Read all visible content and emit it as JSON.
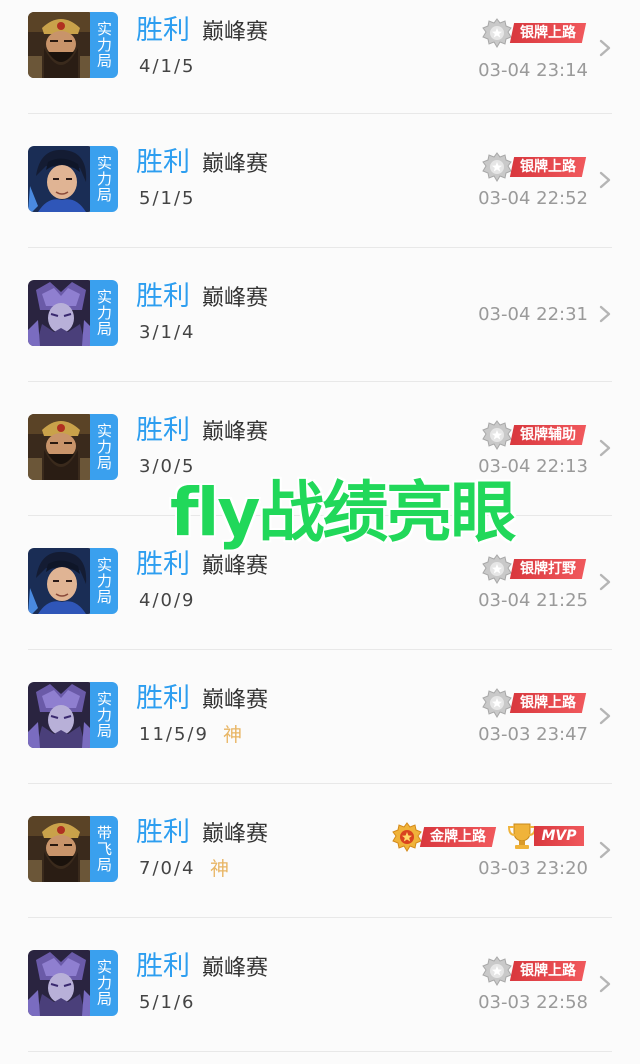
{
  "matches": [
    {
      "hero_icon": "hero-bearded-warrior-icon",
      "mode_badge": "实力局",
      "result": "胜利",
      "mode": "巅峰赛",
      "kda": "4/1/5",
      "god": "",
      "rank_badge": "银牌上路",
      "medal": "silver",
      "mvp": "",
      "time": "03-04 23:14"
    },
    {
      "hero_icon": "hero-blue-hair-icon",
      "mode_badge": "实力局",
      "result": "胜利",
      "mode": "巅峰赛",
      "kda": "5/1/5",
      "god": "",
      "rank_badge": "银牌上路",
      "medal": "silver",
      "mvp": "",
      "time": "03-04 22:52"
    },
    {
      "hero_icon": "hero-purple-armor-icon",
      "mode_badge": "实力局",
      "result": "胜利",
      "mode": "巅峰赛",
      "kda": "3/1/4",
      "god": "",
      "rank_badge": "",
      "medal": "",
      "mvp": "",
      "time": "03-04 22:31"
    },
    {
      "hero_icon": "hero-bearded-warrior-icon",
      "mode_badge": "实力局",
      "result": "胜利",
      "mode": "巅峰赛",
      "kda": "3/0/5",
      "god": "",
      "rank_badge": "银牌辅助",
      "medal": "silver",
      "mvp": "",
      "time": "03-04 22:13"
    },
    {
      "hero_icon": "hero-blue-hair-icon",
      "mode_badge": "实力局",
      "result": "胜利",
      "mode": "巅峰赛",
      "kda": "4/0/9",
      "god": "",
      "rank_badge": "银牌打野",
      "medal": "silver",
      "mvp": "",
      "time": "03-04 21:25"
    },
    {
      "hero_icon": "hero-purple-armor-icon",
      "mode_badge": "实力局",
      "result": "胜利",
      "mode": "巅峰赛",
      "kda": "11/5/9",
      "god": "神",
      "rank_badge": "银牌上路",
      "medal": "silver",
      "mvp": "",
      "time": "03-03 23:47"
    },
    {
      "hero_icon": "hero-bearded-warrior-icon",
      "mode_badge": "带飞局",
      "result": "胜利",
      "mode": "巅峰赛",
      "kda": "7/0/4",
      "god": "神",
      "rank_badge": "金牌上路",
      "medal": "gold",
      "mvp": "MVP",
      "time": "03-03 23:20"
    },
    {
      "hero_icon": "hero-purple-armor-icon",
      "mode_badge": "实力局",
      "result": "胜利",
      "mode": "巅峰赛",
      "kda": "5/1/6",
      "god": "",
      "rank_badge": "银牌上路",
      "medal": "silver",
      "mvp": "",
      "time": "03-03 22:58"
    }
  ],
  "overlay_text": "fly战绩亮眼",
  "colors": {
    "result": "#2d9ef0",
    "mode_badge_bg": "#3aa0ee",
    "rank_label_bg": "#e0464b",
    "god": "#e8b563",
    "overlay": "#21d85a"
  }
}
